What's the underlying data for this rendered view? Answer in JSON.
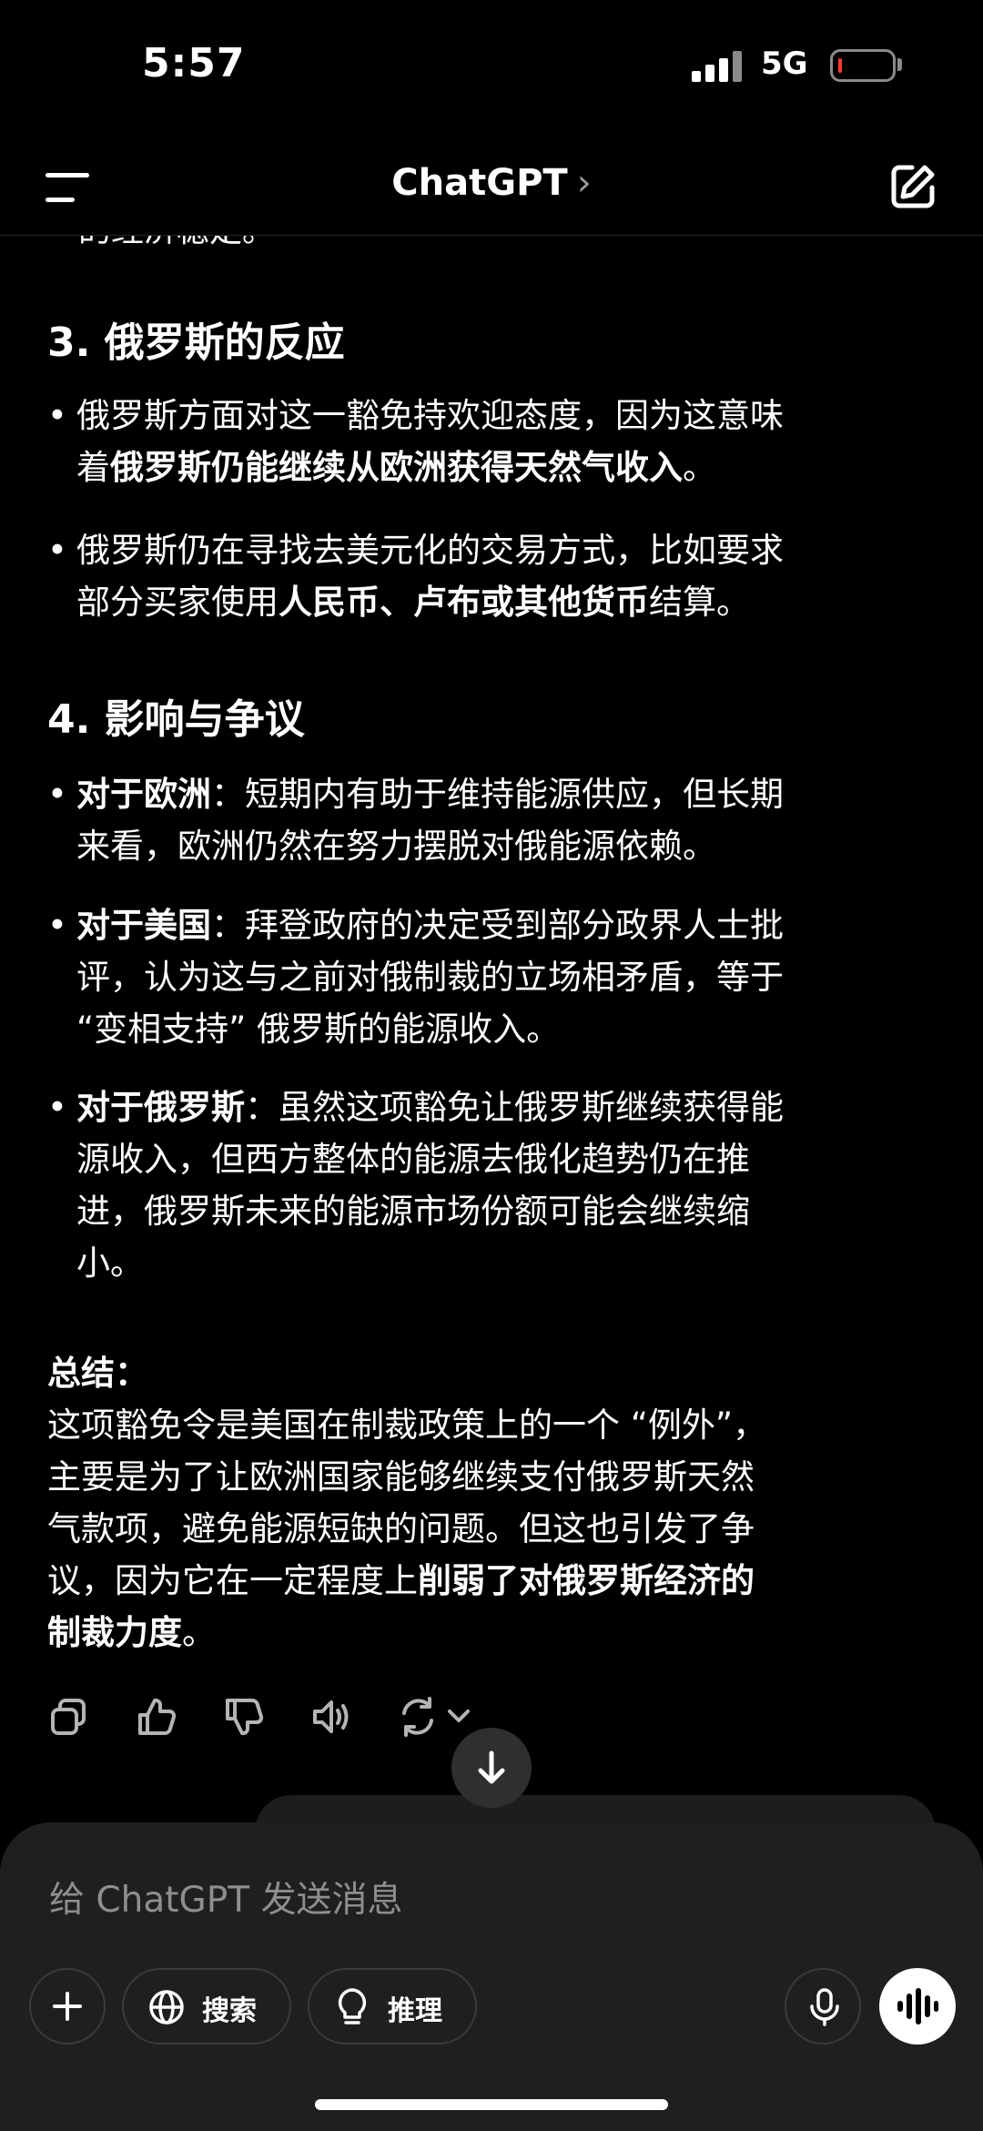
{
  "status": {
    "time": "5:57",
    "network": "5G"
  },
  "header": {
    "title": "ChatGPT",
    "chevron": "›"
  },
  "content": {
    "clipped_line": "的经济稳定。",
    "section3": {
      "heading": "3. 俄罗斯的反应",
      "b1": {
        "line1": "俄罗斯方面对这一豁免持欢迎态度，因为这意味",
        "prefix2": "着",
        "bold": "俄罗斯仍能继续从欧洲获得天然气收入",
        "suffix2": "。"
      },
      "b2": {
        "line1": "俄罗斯仍在寻找去美元化的交易方式，比如要求",
        "prefix2": "部分买家使用",
        "bold": "人民币、卢布或其他货币",
        "suffix2": "结算。"
      }
    },
    "section4": {
      "heading": "4. 影响与争议",
      "b1": {
        "bold": "对于欧洲",
        "line1": "：短期内有助于维持能源供应，但长期",
        "line2": "来看，欧洲仍然在努力摆脱对俄能源依赖。"
      },
      "b2": {
        "bold": "对于美国",
        "line1": "：拜登政府的决定受到部分政界人士批",
        "line2": "评，认为这与之前对俄制裁的立场相矛盾，等于",
        "line3": "“变相支持” 俄罗斯的能源收入。"
      },
      "b3": {
        "bold": "对于俄罗斯",
        "line1": "：虽然这项豁免让俄罗斯继续获得能",
        "line2": "源收入，但西方整体的能源去俄化趋势仍在推",
        "line3": "进，俄罗斯未来的能源市场份额可能会继续缩",
        "line4": "小。"
      }
    },
    "summary": {
      "heading": "总结：",
      "line1": "这项豁免令是美国在制裁政策上的一个 “例外”，",
      "line2": "主要是为了让欧洲国家能够继续支付俄罗斯天然",
      "line3": "气款项，避免能源短缺的问题。但这也引发了争",
      "prefix4": "议，因为它在一定程度上",
      "bold4": "削弱了对俄罗斯经济的",
      "bold5": "制裁力度",
      "suffix5": "。"
    }
  },
  "actions": [
    "copy-icon",
    "thumbs-up-icon",
    "thumbs-down-icon",
    "read-aloud-icon",
    "regenerate-icon"
  ],
  "composer": {
    "placeholder": "给 ChatGPT 发送消息",
    "search_label": "搜索",
    "reason_label": "推理"
  },
  "colors": {
    "background": "#000000",
    "composer": "#1f1f1f",
    "battery_low": "#ff3b30"
  }
}
